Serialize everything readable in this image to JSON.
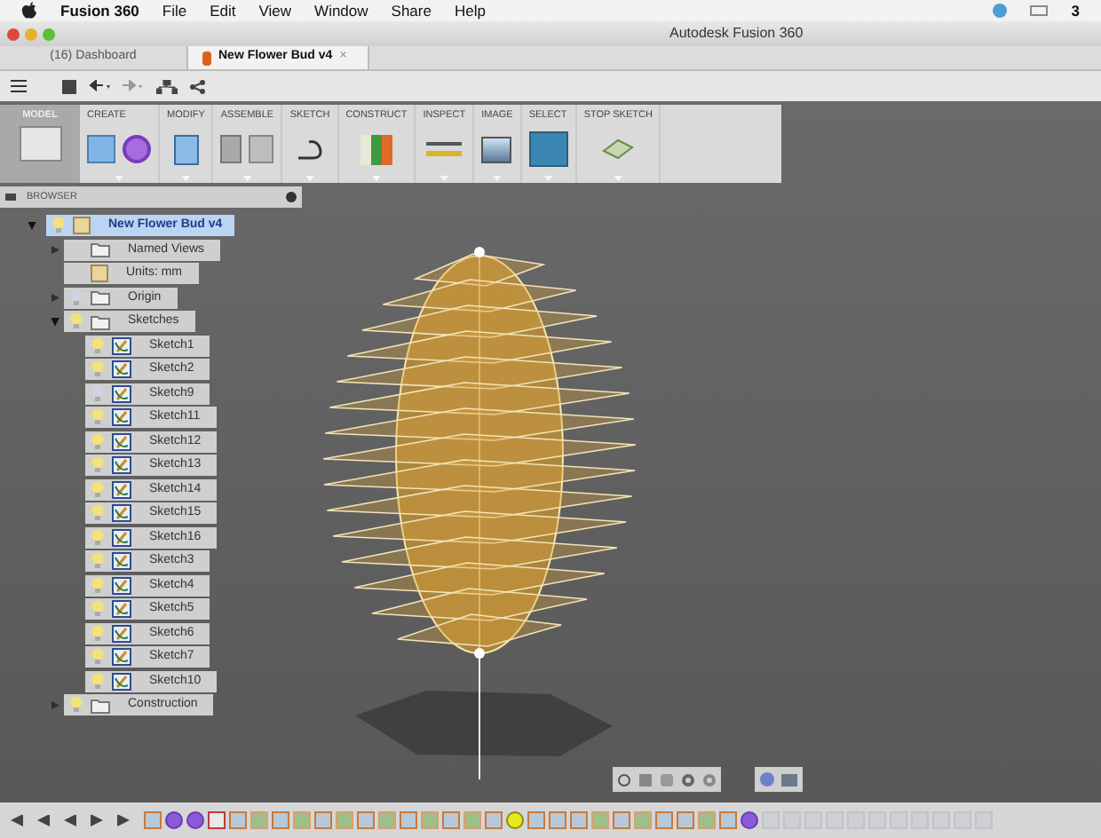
{
  "menu_bar": {
    "app": "Fusion 360",
    "items": [
      "File",
      "Edit",
      "View",
      "Window",
      "Share",
      "Help"
    ],
    "badge": "3"
  },
  "window": {
    "title": "Autodesk Fusion 360"
  },
  "tabs": [
    {
      "label": "(16) Dashboard",
      "selected": false
    },
    {
      "label": "New Flower Bud v4",
      "selected": true,
      "close": "×"
    }
  ],
  "ribbon": {
    "workspace": "MODEL",
    "groups": [
      {
        "label": "CREATE",
        "kind": "create"
      },
      {
        "label": "MODIFY",
        "kind": "modify"
      },
      {
        "label": "ASSEMBLE",
        "kind": "assemble"
      },
      {
        "label": "SKETCH",
        "kind": "sketch"
      },
      {
        "label": "CONSTRUCT",
        "kind": "construct"
      },
      {
        "label": "INSPECT",
        "kind": "inspect"
      },
      {
        "label": "IMAGE",
        "kind": "image"
      },
      {
        "label": "SELECT",
        "kind": "select"
      },
      {
        "label": "STOP SKETCH",
        "kind": "stop"
      }
    ]
  },
  "browser": {
    "title": "BROWSER",
    "root": {
      "label": "New Flower Bud v4",
      "selected": true,
      "expanded": true,
      "children": [
        {
          "label": "Named Views",
          "kind": "folder",
          "expanded": false
        },
        {
          "label": "Units: mm",
          "kind": "units"
        },
        {
          "label": "Origin",
          "kind": "folder",
          "expanded": false,
          "visible": false
        },
        {
          "label": "Sketches",
          "kind": "folder",
          "expanded": true,
          "visible": true,
          "children": [
            {
              "label": "Sketch1",
              "kind": "sketch",
              "visible": true
            },
            {
              "label": "Sketch2",
              "kind": "sketch",
              "visible": true
            },
            {
              "label": "Sketch9",
              "kind": "sketch",
              "visible": false
            },
            {
              "label": "Sketch11",
              "kind": "sketch",
              "visible": true
            },
            {
              "label": "Sketch12",
              "kind": "sketch",
              "visible": true
            },
            {
              "label": "Sketch13",
              "kind": "sketch",
              "visible": true
            },
            {
              "label": "Sketch14",
              "kind": "sketch",
              "visible": true
            },
            {
              "label": "Sketch15",
              "kind": "sketch",
              "visible": true
            },
            {
              "label": "Sketch16",
              "kind": "sketch",
              "visible": true
            },
            {
              "label": "Sketch3",
              "kind": "sketch",
              "visible": true
            },
            {
              "label": "Sketch4",
              "kind": "sketch",
              "visible": true
            },
            {
              "label": "Sketch5",
              "kind": "sketch",
              "visible": true
            },
            {
              "label": "Sketch6",
              "kind": "sketch",
              "visible": true
            },
            {
              "label": "Sketch7",
              "kind": "sketch",
              "visible": true
            },
            {
              "label": "Sketch10",
              "kind": "sketch",
              "visible": true
            }
          ]
        },
        {
          "label": "Construction",
          "kind": "folder",
          "expanded": false,
          "visible": true
        }
      ]
    }
  },
  "timeline": {
    "features": [
      {
        "kind": "sketch",
        "selected": false
      },
      {
        "kind": "point",
        "selected": false
      },
      {
        "kind": "point",
        "selected": false
      },
      {
        "kind": "extrude",
        "selected": false
      },
      {
        "kind": "sketch",
        "selected": false
      },
      {
        "kind": "plane",
        "selected": false
      },
      {
        "kind": "sketch",
        "selected": false
      },
      {
        "kind": "plane",
        "selected": false
      },
      {
        "kind": "sketch",
        "selected": false
      },
      {
        "kind": "plane",
        "selected": false
      },
      {
        "kind": "sketch",
        "selected": false
      },
      {
        "kind": "plane",
        "selected": false
      },
      {
        "kind": "sketch",
        "selected": false
      },
      {
        "kind": "plane",
        "selected": false
      },
      {
        "kind": "sketch",
        "selected": false
      },
      {
        "kind": "plane",
        "selected": false
      },
      {
        "kind": "sketch",
        "selected": false
      },
      {
        "kind": "plane",
        "selected": true
      },
      {
        "kind": "sketch",
        "selected": false
      },
      {
        "kind": "sketch",
        "selected": false
      },
      {
        "kind": "sketch",
        "selected": false
      },
      {
        "kind": "plane",
        "selected": false
      },
      {
        "kind": "sketch",
        "selected": false
      },
      {
        "kind": "plane",
        "selected": false
      },
      {
        "kind": "sketch",
        "selected": false
      },
      {
        "kind": "sketch",
        "selected": false
      },
      {
        "kind": "plane",
        "selected": false
      },
      {
        "kind": "sketch",
        "selected": false
      },
      {
        "kind": "point",
        "selected": false
      },
      {
        "kind": "ghost",
        "selected": false
      },
      {
        "kind": "ghost",
        "selected": false
      },
      {
        "kind": "ghost",
        "selected": false
      },
      {
        "kind": "ghost",
        "selected": false
      },
      {
        "kind": "ghost",
        "selected": false
      },
      {
        "kind": "ghost",
        "selected": false
      },
      {
        "kind": "ghost",
        "selected": false
      },
      {
        "kind": "ghost",
        "selected": false
      },
      {
        "kind": "ghost",
        "selected": false
      },
      {
        "kind": "ghost",
        "selected": false
      },
      {
        "kind": "ghost",
        "selected": false
      }
    ]
  }
}
